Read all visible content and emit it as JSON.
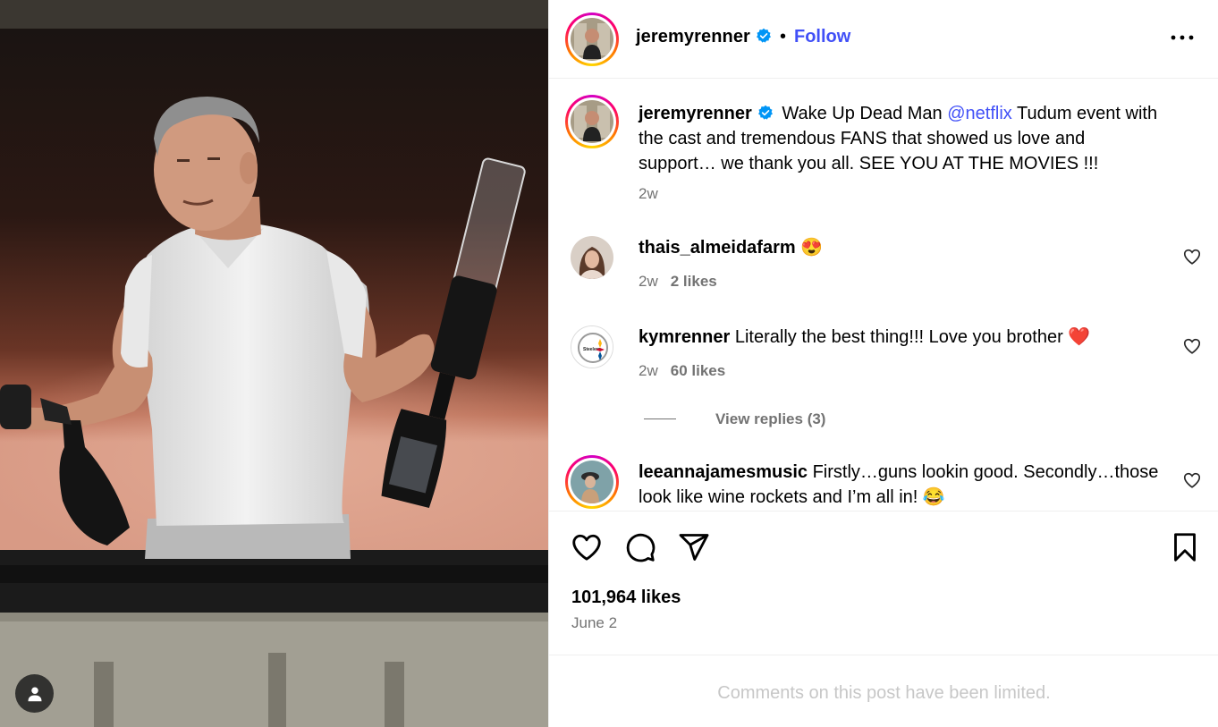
{
  "post": {
    "author": "jeremyrenner",
    "follow_label": "Follow",
    "separator": "•",
    "caption": {
      "text_before_mention": "Wake Up Dead Man ",
      "mention": "@netflix",
      "text_after_mention_line1": " Tudum event with",
      "line2": "the cast and tremendous FANS that showed us love and",
      "line3": "support… we thank you all. SEE YOU AT THE MOVIES !!!",
      "age": "2w"
    },
    "likes": "101,964 likes",
    "date": "June 2",
    "comments_limited": "Comments on this post have been limited."
  },
  "comments": [
    {
      "username": "thais_almeidafarm",
      "text": "",
      "emoji": "😍",
      "age": "2w",
      "likes": "2 likes"
    },
    {
      "username": "kymrenner",
      "text": "Literally the best thing!!! Love you brother",
      "emoji": "❤️",
      "age": "2w",
      "likes": "60 likes",
      "replies": "View replies (3)"
    },
    {
      "username": "leeannajamesmusic",
      "text_line1": "Firstly…guns lookin good. Secondly…those",
      "text_line2": "look like wine rockets and I’m all in!",
      "emoji": "😂"
    }
  ],
  "icons": {
    "verified": "verified-badge-icon",
    "more": "more-options-icon",
    "like": "heart-icon",
    "comment": "comment-icon",
    "share": "share-icon",
    "save": "bookmark-icon",
    "tag": "user-tag-icon"
  },
  "colors": {
    "link": "#4150f7",
    "verified": "#0095f6",
    "muted": "#737373",
    "limited": "#c7c7c7"
  },
  "avatars": {
    "steelers_logo_text": "Steelers"
  }
}
